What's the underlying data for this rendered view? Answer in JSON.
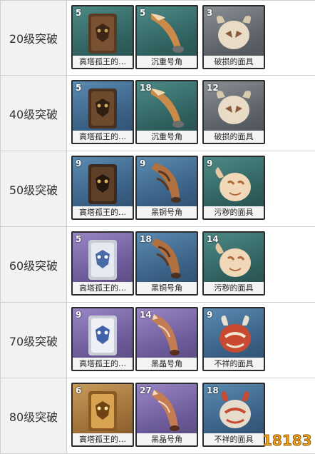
{
  "rows": [
    {
      "label": "20级突破",
      "items": [
        {
          "qty": "5",
          "name": "高塔孤王的…",
          "icon": "tower-king-relic-icon",
          "bg": "teal"
        },
        {
          "qty": "5",
          "name": "沉重号角",
          "icon": "heavy-horn-icon",
          "bg": "teal"
        },
        {
          "qty": "3",
          "name": "破损的面具",
          "icon": "damaged-mask-icon",
          "bg": "slate"
        }
      ]
    },
    {
      "label": "40级突破",
      "items": [
        {
          "qty": "5",
          "name": "高塔孤王的…",
          "icon": "tower-king-relic-icon",
          "bg": "blue"
        },
        {
          "qty": "18",
          "name": "沉重号角",
          "icon": "heavy-horn-icon",
          "bg": "teal"
        },
        {
          "qty": "12",
          "name": "破损的面具",
          "icon": "damaged-mask-icon",
          "bg": "slate"
        }
      ]
    },
    {
      "label": "50级突破",
      "items": [
        {
          "qty": "9",
          "name": "高塔孤王的…",
          "icon": "tower-king-relic-icon",
          "bg": "blue"
        },
        {
          "qty": "9",
          "name": "黑铜号角",
          "icon": "black-bronze-horn-icon",
          "bg": "blue"
        },
        {
          "qty": "9",
          "name": "污秽的面具",
          "icon": "stained-mask-icon",
          "bg": "teal"
        }
      ]
    },
    {
      "label": "60级突破",
      "items": [
        {
          "qty": "5",
          "name": "高塔孤王的…",
          "icon": "tower-king-relic-icon",
          "bg": "purple"
        },
        {
          "qty": "18",
          "name": "黑铜号角",
          "icon": "black-bronze-horn-icon",
          "bg": "blue"
        },
        {
          "qty": "14",
          "name": "污秽的面具",
          "icon": "stained-mask-icon",
          "bg": "teal"
        }
      ]
    },
    {
      "label": "70级突破",
      "items": [
        {
          "qty": "9",
          "name": "高塔孤王的…",
          "icon": "tower-king-relic-icon",
          "bg": "purple"
        },
        {
          "qty": "14",
          "name": "黑晶号角",
          "icon": "black-crystal-horn-icon",
          "bg": "purple"
        },
        {
          "qty": "9",
          "name": "不祥的面具",
          "icon": "ominous-mask-icon",
          "bg": "blue"
        }
      ]
    },
    {
      "label": "80级突破",
      "items": [
        {
          "qty": "6",
          "name": "高塔孤王的…",
          "icon": "tower-king-relic-icon",
          "bg": "gold"
        },
        {
          "qty": "27",
          "name": "黑晶号角",
          "icon": "black-crystal-horn-icon",
          "bg": "purple"
        },
        {
          "qty": "18",
          "name": "不祥的面具",
          "icon": "ominous-mask-icon",
          "bg": "blue"
        }
      ]
    }
  ],
  "watermark": {
    "text": "18183",
    "icon": "site-logo-icon"
  },
  "colors": {
    "border": "#cfcfcf",
    "label_bg": "#f2f2f2",
    "frame": "#2b2b2b"
  }
}
